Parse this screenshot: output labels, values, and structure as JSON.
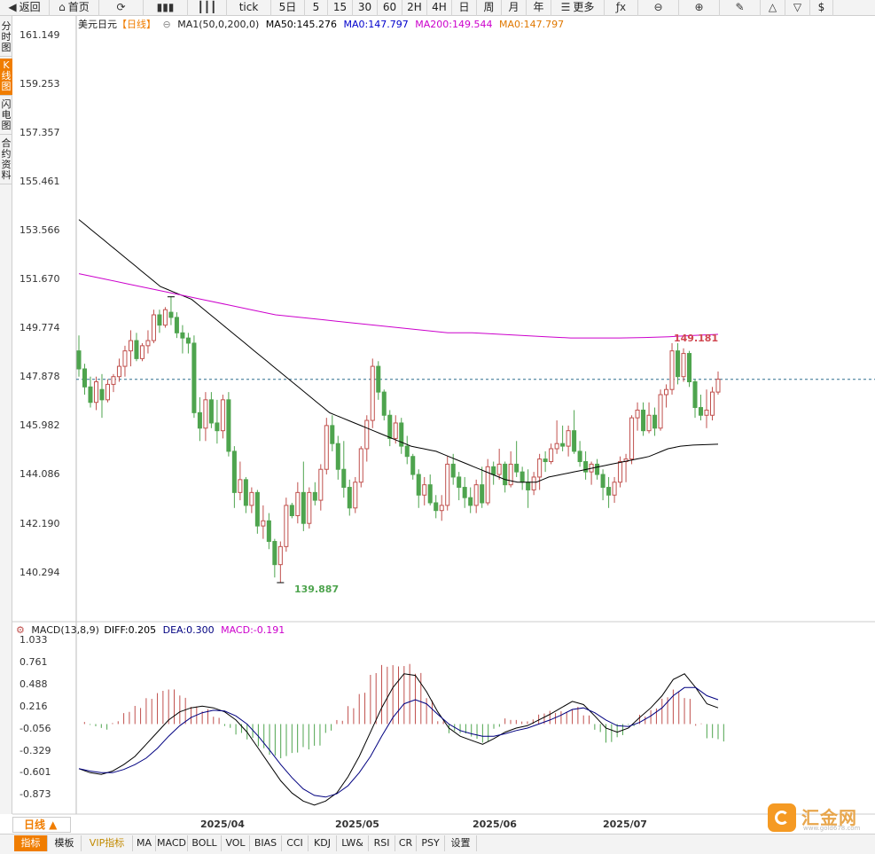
{
  "toolbar": {
    "items": [
      {
        "label": "返回",
        "icon": "back-icon",
        "glyph": "◀"
      },
      {
        "label": "首页",
        "icon": "home-icon",
        "glyph": "⌂"
      },
      {
        "label": "",
        "icon": "refresh-icon",
        "glyph": "⟳"
      },
      {
        "label": "",
        "icon": "bar-chart-icon",
        "glyph": "▮▮▮"
      },
      {
        "label": "",
        "icon": "candlestick-icon",
        "glyph": "┃┃┃"
      },
      {
        "label": "tick",
        "icon": "",
        "glyph": ""
      },
      {
        "label": "5日",
        "icon": "",
        "glyph": ""
      },
      {
        "label": "5",
        "icon": "",
        "glyph": ""
      },
      {
        "label": "15",
        "icon": "",
        "glyph": ""
      },
      {
        "label": "30",
        "icon": "",
        "glyph": ""
      },
      {
        "label": "60",
        "icon": "",
        "glyph": ""
      },
      {
        "label": "2H",
        "icon": "",
        "glyph": ""
      },
      {
        "label": "4H",
        "icon": "",
        "glyph": ""
      },
      {
        "label": "日",
        "icon": "",
        "glyph": ""
      },
      {
        "label": "周",
        "icon": "",
        "glyph": ""
      },
      {
        "label": "月",
        "icon": "",
        "glyph": ""
      },
      {
        "label": "年",
        "icon": "",
        "glyph": ""
      },
      {
        "label": "更多",
        "icon": "menu-icon",
        "glyph": "☰"
      },
      {
        "label": "",
        "icon": "formula-icon",
        "glyph": "ƒx"
      },
      {
        "label": "",
        "icon": "zoom-out-icon",
        "glyph": "⊖"
      },
      {
        "label": "",
        "icon": "zoom-in-icon",
        "glyph": "⊕"
      },
      {
        "label": "",
        "icon": "pen-icon",
        "glyph": "✎"
      },
      {
        "label": "",
        "icon": "triangle-up-icon",
        "glyph": "△"
      },
      {
        "label": "",
        "icon": "triangle-down-icon",
        "glyph": "▽"
      },
      {
        "label": "$",
        "icon": "",
        "glyph": ""
      }
    ]
  },
  "left_tabs": [
    {
      "label": "分时图",
      "active": false
    },
    {
      "label": "K线图",
      "active": true
    },
    {
      "label": "闪电图",
      "active": false
    },
    {
      "label": "合约资料",
      "active": false
    }
  ],
  "main_legend": {
    "symbol": "美元日元",
    "period": "【日线】",
    "ma_name": "MA1(50,0,200,0)",
    "ma50": "MA50:145.276",
    "ma0a": "MA0:147.797",
    "ma200": "MA200:149.544",
    "ma0b": "MA0:147.797"
  },
  "macd_legend": {
    "name": "MACD(13,8,9)",
    "diff": "DIFF:0.205",
    "dea": "DEA:0.300",
    "macd": "MACD:-0.191"
  },
  "price_axis": [
    "161.149",
    "159.253",
    "157.357",
    "155.461",
    "153.566",
    "151.670",
    "149.774",
    "147.878",
    "145.982",
    "144.086",
    "142.190",
    "140.294"
  ],
  "macd_axis": [
    "1.033",
    "0.761",
    "0.488",
    "0.216",
    "-0.056",
    "-0.329",
    "-0.601",
    "-0.873"
  ],
  "date_axis": [
    "2025/04",
    "2025/05",
    "2025/06",
    "2025/07"
  ],
  "annotations": {
    "high": "149.181",
    "low": "139.887"
  },
  "period_selector": "日线 ▲",
  "bottom_tabs": [
    {
      "label": "指标",
      "active": true
    },
    {
      "label": "模板"
    },
    {
      "label": "VIP指标",
      "vip": true
    },
    {
      "label": "MA"
    },
    {
      "label": "MACD"
    },
    {
      "label": "BOLL"
    },
    {
      "label": "VOL"
    },
    {
      "label": "BIAS"
    },
    {
      "label": "CCI"
    },
    {
      "label": "KDJ"
    },
    {
      "label": "LW&"
    },
    {
      "label": "RSI"
    },
    {
      "label": "CR"
    },
    {
      "label": "PSY"
    },
    {
      "label": "设置"
    }
  ],
  "watermark": {
    "name": "汇金网",
    "url": "www.gold678.com"
  },
  "colors": {
    "up": "#c0504d",
    "down": "#4ea44e",
    "ma50": "#000000",
    "ma200": "#cc00cc",
    "diff": "#000000",
    "dea": "#000080",
    "macd_label": "#cc00cc",
    "current_line": "#2f6f8f",
    "accent": "#f07d00"
  },
  "chart_data": {
    "type": "candlestick",
    "current_price": 147.797,
    "price_range": [
      139.4,
      161.6
    ],
    "candles": [
      [
        148.9,
        149.5,
        147.9,
        148.2
      ],
      [
        148.2,
        148.4,
        147.2,
        147.5
      ],
      [
        147.5,
        147.9,
        146.7,
        146.9
      ],
      [
        146.9,
        147.9,
        146.6,
        147.7
      ],
      [
        147.4,
        148.0,
        146.3,
        147.0
      ],
      [
        147.0,
        147.8,
        146.9,
        147.6
      ],
      [
        147.6,
        148.0,
        147.3,
        147.9
      ],
      [
        147.9,
        148.6,
        147.7,
        148.3
      ],
      [
        148.3,
        149.1,
        147.9,
        148.9
      ],
      [
        148.9,
        149.7,
        148.3,
        149.3
      ],
      [
        149.3,
        149.6,
        148.5,
        148.6
      ],
      [
        148.6,
        149.2,
        148.5,
        149.1
      ],
      [
        149.1,
        149.7,
        148.8,
        149.3
      ],
      [
        149.3,
        150.5,
        149.2,
        150.3
      ],
      [
        150.3,
        150.5,
        149.6,
        149.9
      ],
      [
        149.9,
        150.6,
        149.8,
        150.5
      ],
      [
        150.4,
        151.0,
        149.9,
        150.2
      ],
      [
        150.2,
        150.4,
        149.4,
        149.6
      ],
      [
        149.6,
        149.9,
        148.8,
        149.4
      ],
      [
        149.4,
        149.6,
        148.8,
        149.2
      ],
      [
        149.2,
        149.5,
        146.3,
        146.5
      ],
      [
        146.5,
        147.1,
        145.4,
        145.9
      ],
      [
        145.9,
        147.3,
        145.4,
        147.0
      ],
      [
        147.0,
        147.3,
        145.9,
        146.1
      ],
      [
        146.1,
        147.0,
        145.3,
        145.8
      ],
      [
        145.8,
        147.2,
        145.5,
        147.0
      ],
      [
        147.0,
        147.3,
        144.8,
        145.0
      ],
      [
        145.0,
        145.2,
        142.8,
        143.4
      ],
      [
        143.4,
        144.6,
        143.1,
        143.9
      ],
      [
        143.9,
        144.0,
        142.6,
        142.9
      ],
      [
        142.9,
        143.6,
        142.6,
        143.4
      ],
      [
        143.4,
        143.5,
        141.8,
        142.1
      ],
      [
        142.1,
        142.9,
        141.6,
        142.3
      ],
      [
        142.3,
        142.6,
        141.2,
        141.5
      ],
      [
        141.5,
        141.6,
        140.1,
        140.6
      ],
      [
        140.6,
        141.5,
        139.9,
        141.3
      ],
      [
        141.3,
        143.2,
        141.1,
        142.9
      ],
      [
        142.9,
        143.0,
        142.4,
        142.5
      ],
      [
        142.5,
        143.8,
        142.2,
        143.4
      ],
      [
        143.4,
        144.6,
        141.9,
        142.2
      ],
      [
        142.2,
        143.6,
        142.0,
        143.4
      ],
      [
        143.4,
        143.8,
        142.9,
        143.1
      ],
      [
        143.1,
        144.5,
        142.7,
        144.3
      ],
      [
        144.3,
        146.3,
        144.1,
        146.0
      ],
      [
        146.0,
        146.4,
        145.0,
        145.3
      ],
      [
        145.3,
        145.6,
        143.9,
        144.3
      ],
      [
        144.3,
        145.4,
        143.2,
        143.6
      ],
      [
        143.6,
        143.9,
        142.5,
        142.8
      ],
      [
        142.8,
        144.0,
        142.6,
        143.8
      ],
      [
        143.8,
        145.2,
        143.6,
        145.1
      ],
      [
        145.1,
        146.4,
        144.6,
        146.2
      ],
      [
        146.2,
        148.6,
        145.9,
        148.3
      ],
      [
        148.3,
        148.5,
        147.0,
        147.3
      ],
      [
        147.3,
        147.4,
        146.2,
        146.4
      ],
      [
        146.4,
        146.6,
        145.2,
        145.5
      ],
      [
        145.5,
        146.4,
        145.3,
        146.1
      ],
      [
        146.1,
        146.3,
        144.9,
        145.2
      ],
      [
        145.2,
        145.6,
        144.5,
        144.8
      ],
      [
        144.8,
        144.9,
        143.9,
        144.1
      ],
      [
        144.1,
        144.3,
        142.8,
        143.3
      ],
      [
        143.3,
        144.0,
        142.9,
        143.7
      ],
      [
        143.7,
        144.1,
        142.9,
        143.0
      ],
      [
        143.0,
        143.3,
        142.4,
        142.7
      ],
      [
        142.7,
        143.3,
        142.3,
        142.9
      ],
      [
        142.9,
        144.8,
        142.7,
        144.5
      ],
      [
        144.5,
        144.9,
        143.7,
        144.0
      ],
      [
        144.0,
        144.2,
        143.1,
        143.6
      ],
      [
        143.6,
        144.0,
        142.8,
        143.2
      ],
      [
        143.2,
        143.6,
        142.6,
        142.9
      ],
      [
        142.9,
        143.9,
        142.6,
        143.7
      ],
      [
        143.7,
        144.4,
        142.8,
        143.0
      ],
      [
        143.0,
        144.7,
        142.9,
        144.4
      ],
      [
        144.4,
        144.6,
        143.7,
        144.1
      ],
      [
        144.1,
        145.1,
        143.9,
        144.5
      ],
      [
        144.5,
        144.6,
        143.4,
        143.7
      ],
      [
        143.7,
        145.0,
        143.6,
        144.5
      ],
      [
        144.5,
        145.4,
        144.0,
        144.2
      ],
      [
        144.2,
        144.4,
        143.5,
        143.8
      ],
      [
        143.8,
        144.3,
        142.8,
        143.5
      ],
      [
        143.5,
        144.2,
        143.3,
        144.0
      ],
      [
        144.0,
        144.9,
        143.5,
        144.7
      ],
      [
        144.7,
        145.0,
        144.2,
        144.6
      ],
      [
        144.6,
        145.3,
        144.5,
        145.1
      ],
      [
        145.1,
        146.2,
        144.9,
        145.3
      ],
      [
        145.3,
        146.0,
        145.0,
        145.2
      ],
      [
        145.2,
        146.0,
        144.8,
        145.8
      ],
      [
        145.8,
        146.6,
        144.9,
        145.0
      ],
      [
        145.0,
        145.4,
        144.4,
        144.6
      ],
      [
        144.6,
        145.0,
        143.9,
        144.2
      ],
      [
        144.2,
        144.6,
        143.7,
        144.5
      ],
      [
        144.5,
        144.7,
        143.9,
        144.1
      ],
      [
        144.1,
        144.3,
        143.1,
        143.6
      ],
      [
        143.6,
        144.0,
        142.8,
        143.3
      ],
      [
        143.3,
        144.0,
        143.0,
        143.8
      ],
      [
        143.8,
        144.8,
        143.6,
        144.6
      ],
      [
        144.6,
        144.9,
        143.8,
        144.7
      ],
      [
        144.7,
        146.4,
        144.5,
        146.3
      ],
      [
        146.3,
        146.9,
        145.8,
        146.6
      ],
      [
        146.6,
        146.9,
        145.6,
        145.8
      ],
      [
        145.8,
        146.9,
        145.7,
        146.4
      ],
      [
        146.4,
        146.7,
        145.6,
        145.9
      ],
      [
        145.9,
        147.4,
        145.8,
        147.2
      ],
      [
        147.2,
        147.6,
        146.7,
        147.4
      ],
      [
        147.4,
        149.2,
        147.2,
        148.9
      ],
      [
        148.9,
        149.2,
        147.6,
        147.9
      ],
      [
        147.9,
        149.0,
        147.7,
        148.8
      ],
      [
        148.8,
        148.9,
        147.5,
        147.7
      ],
      [
        147.7,
        147.8,
        146.3,
        146.7
      ],
      [
        146.7,
        147.2,
        146.2,
        146.4
      ],
      [
        146.4,
        147.4,
        145.9,
        146.6
      ],
      [
        146.4,
        147.5,
        146.2,
        147.3
      ],
      [
        147.3,
        148.1,
        147.2,
        147.8
      ]
    ],
    "ma50": [
      154.0,
      153.8,
      153.6,
      153.4,
      153.2,
      153.0,
      152.8,
      152.6,
      152.4,
      152.2,
      152.0,
      151.8,
      151.6,
      151.4,
      151.3,
      151.2,
      151.1,
      151.0,
      150.9,
      150.7,
      150.5,
      150.3,
      150.1,
      149.9,
      149.7,
      149.5,
      149.3,
      149.1,
      148.9,
      148.7,
      148.5,
      148.3,
      148.1,
      147.9,
      147.7,
      147.5,
      147.3,
      147.1,
      146.9,
      146.7,
      146.5,
      146.4,
      146.3,
      146.2,
      146.1,
      146.0,
      145.9,
      145.8,
      145.7,
      145.6,
      145.5,
      145.4,
      145.3,
      145.2,
      145.15,
      145.1,
      145.05,
      145.0,
      144.9,
      144.8,
      144.7,
      144.6,
      144.5,
      144.4,
      144.3,
      144.2,
      144.1,
      144.0,
      143.9,
      143.85,
      143.8,
      143.8,
      143.8,
      143.8,
      143.9,
      144.0,
      144.05,
      144.1,
      144.15,
      144.2,
      144.25,
      144.3,
      144.35,
      144.4,
      144.45,
      144.5,
      144.55,
      144.6,
      144.65,
      144.7,
      144.75,
      144.8,
      144.9,
      145.0,
      145.1,
      145.15,
      145.2,
      145.22,
      145.24,
      145.25,
      145.26,
      145.27,
      145.276
    ],
    "ma200": [
      151.9,
      151.7,
      151.5,
      151.3,
      151.1,
      150.9,
      150.7,
      150.5,
      150.3,
      150.2,
      150.1,
      150.0,
      149.9,
      149.8,
      149.7,
      149.6,
      149.6,
      149.55,
      149.5,
      149.45,
      149.4,
      149.4,
      149.4,
      149.42,
      149.45,
      149.5,
      149.544
    ],
    "macd": {
      "diff": [
        -0.55,
        -0.6,
        -0.62,
        -0.58,
        -0.5,
        -0.4,
        -0.25,
        -0.1,
        0.05,
        0.15,
        0.2,
        0.22,
        0.2,
        0.15,
        0.05,
        -0.1,
        -0.3,
        -0.5,
        -0.7,
        -0.85,
        -0.95,
        -1.0,
        -0.95,
        -0.85,
        -0.65,
        -0.4,
        -0.1,
        0.2,
        0.45,
        0.62,
        0.6,
        0.4,
        0.15,
        -0.05,
        -0.15,
        -0.2,
        -0.25,
        -0.18,
        -0.1,
        -0.05,
        -0.02,
        0.05,
        0.12,
        0.2,
        0.28,
        0.24,
        0.1,
        -0.05,
        -0.1,
        -0.05,
        0.08,
        0.2,
        0.35,
        0.55,
        0.62,
        0.45,
        0.25,
        0.2
      ],
      "dea": [
        -0.55,
        -0.58,
        -0.6,
        -0.6,
        -0.56,
        -0.5,
        -0.42,
        -0.3,
        -0.15,
        -0.02,
        0.08,
        0.14,
        0.17,
        0.16,
        0.1,
        0.0,
        -0.15,
        -0.32,
        -0.5,
        -0.66,
        -0.8,
        -0.88,
        -0.9,
        -0.86,
        -0.76,
        -0.6,
        -0.4,
        -0.15,
        0.08,
        0.25,
        0.3,
        0.25,
        0.12,
        0.0,
        -0.08,
        -0.12,
        -0.15,
        -0.15,
        -0.12,
        -0.08,
        -0.05,
        0.0,
        0.05,
        0.11,
        0.18,
        0.2,
        0.14,
        0.05,
        -0.02,
        -0.03,
        0.02,
        0.1,
        0.2,
        0.35,
        0.45,
        0.45,
        0.35,
        0.3
      ]
    }
  }
}
